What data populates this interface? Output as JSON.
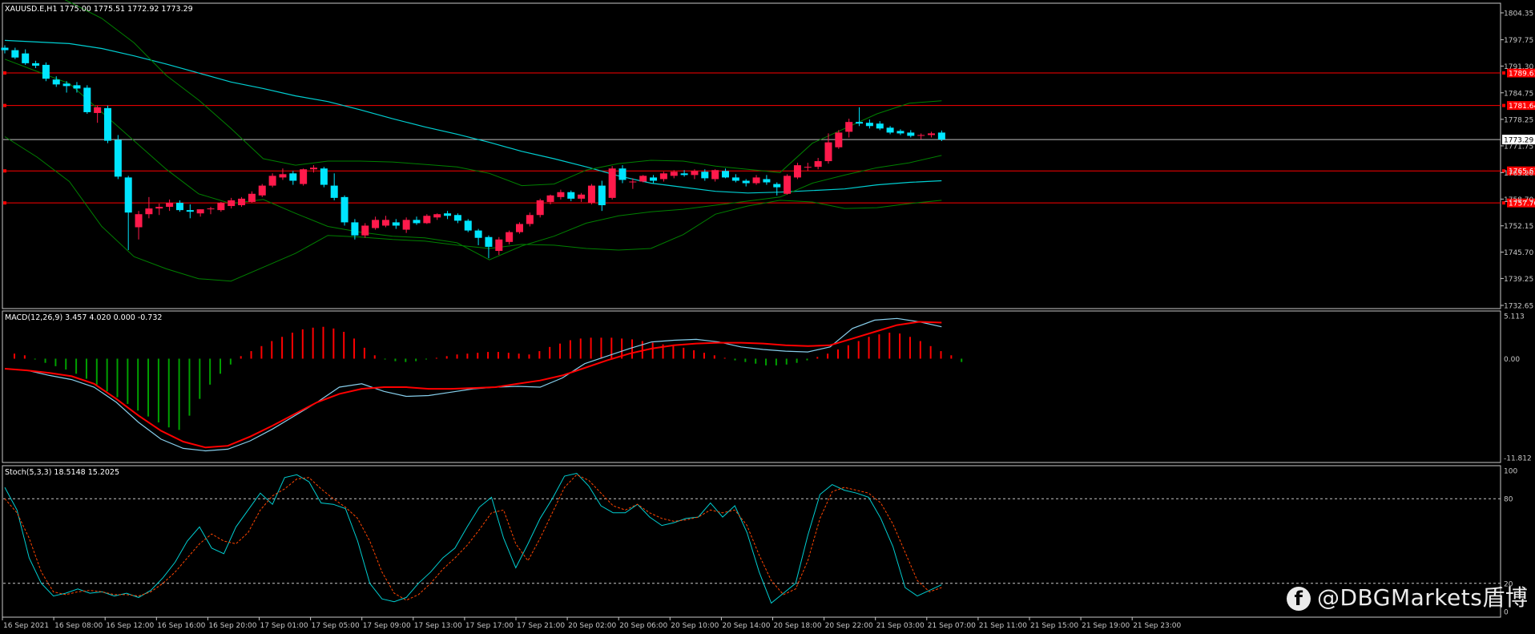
{
  "chart_data": [
    {
      "type": "candlestick",
      "title": "XAUUSD.E,H1  1775.00 1775.51 1772.92 1773.29",
      "symbol": "XAUUSD.E,H1",
      "ohlc_header": {
        "open": 1775.0,
        "high": 1775.51,
        "low": 1772.92,
        "close": 1773.29
      },
      "ylim": [
        1732.65,
        1804.35
      ],
      "y_ticks": [
        "1804.35",
        "1797.75",
        "1791.30",
        "1784.75",
        "1778.25",
        "1771.75",
        "1765.20",
        "1758.70",
        "1752.15",
        "1745.70",
        "1739.25",
        "1732.65"
      ],
      "x_tick_labels": [
        "16 Sep 2021",
        "16 Sep 08:00",
        "16 Sep 12:00",
        "16 Sep 16:00",
        "16 Sep 20:00",
        "17 Sep 01:00",
        "17 Sep 05:00",
        "17 Sep 09:00",
        "17 Sep 13:00",
        "17 Sep 17:00",
        "17 Sep 21:00",
        "20 Sep 02:00",
        "20 Sep 06:00",
        "20 Sep 10:00",
        "20 Sep 14:00",
        "20 Sep 18:00",
        "20 Sep 22:00",
        "21 Sep 03:00",
        "21 Sep 07:00",
        "21 Sep 11:00",
        "21 Sep 15:00",
        "21 Sep 19:00",
        "21 Sep 23:00"
      ],
      "current_price_label": "1773.29",
      "current_price": 1773.29,
      "horizontal_levels": [
        {
          "label": "1789.61",
          "price": 1789.61
        },
        {
          "label": "1781.64",
          "price": 1781.64
        },
        {
          "label": "1765.61",
          "price": 1765.61
        },
        {
          "label": "1757.76",
          "price": 1757.76
        }
      ],
      "candles": [
        [
          1795.8,
          1796.4,
          1794.4,
          1795.2
        ],
        [
          1795.2,
          1795.8,
          1793.0,
          1793.4
        ],
        [
          1794.4,
          1795.4,
          1791.6,
          1792.0
        ],
        [
          1792.0,
          1792.6,
          1790.8,
          1791.4
        ],
        [
          1791.6,
          1792.2,
          1787.6,
          1788.2
        ],
        [
          1788.0,
          1788.8,
          1786.2,
          1786.8
        ],
        [
          1787.0,
          1787.6,
          1784.8,
          1786.4
        ],
        [
          1786.6,
          1787.4,
          1784.8,
          1785.8
        ],
        [
          1786.0,
          1786.6,
          1779.6,
          1780.0
        ],
        [
          1779.8,
          1781.6,
          1777.4,
          1781.2
        ],
        [
          1781.0,
          1781.6,
          1772.4,
          1773.0
        ],
        [
          1773.2,
          1774.4,
          1763.6,
          1764.2
        ],
        [
          1764.0,
          1764.4,
          1746.2,
          1755.4
        ],
        [
          1751.8,
          1755.8,
          1748.8,
          1755.0
        ],
        [
          1755.0,
          1759.2,
          1754.0,
          1756.4
        ],
        [
          1756.4,
          1757.6,
          1754.8,
          1756.8
        ],
        [
          1756.8,
          1758.6,
          1755.8,
          1757.8
        ],
        [
          1757.8,
          1758.4,
          1755.6,
          1756.0
        ],
        [
          1756.0,
          1757.4,
          1754.0,
          1755.6
        ],
        [
          1755.2,
          1756.2,
          1754.4,
          1756.2
        ],
        [
          1756.2,
          1756.8,
          1755.0,
          1756.4
        ],
        [
          1756.0,
          1758.0,
          1755.6,
          1757.8
        ],
        [
          1757.0,
          1759.0,
          1756.4,
          1758.4
        ],
        [
          1757.2,
          1759.2,
          1756.8,
          1758.8
        ],
        [
          1758.0,
          1760.6,
          1757.8,
          1760.0
        ],
        [
          1759.6,
          1762.4,
          1759.2,
          1762.0
        ],
        [
          1762.0,
          1765.0,
          1761.6,
          1764.4
        ],
        [
          1764.0,
          1766.2,
          1763.4,
          1764.8
        ],
        [
          1765.0,
          1765.6,
          1762.2,
          1763.2
        ],
        [
          1762.4,
          1766.2,
          1762.0,
          1766.0
        ],
        [
          1766.0,
          1767.0,
          1765.2,
          1766.4
        ],
        [
          1766.2,
          1766.6,
          1761.6,
          1762.2
        ],
        [
          1762.0,
          1765.0,
          1758.4,
          1759.0
        ],
        [
          1759.2,
          1759.6,
          1752.2,
          1753.0
        ],
        [
          1753.0,
          1753.8,
          1748.8,
          1749.8
        ],
        [
          1749.8,
          1752.8,
          1749.2,
          1752.2
        ],
        [
          1751.6,
          1754.4,
          1751.2,
          1753.6
        ],
        [
          1752.2,
          1754.6,
          1751.8,
          1753.6
        ],
        [
          1753.0,
          1753.8,
          1751.4,
          1752.2
        ],
        [
          1751.2,
          1754.2,
          1750.4,
          1753.6
        ],
        [
          1753.6,
          1754.4,
          1752.4,
          1752.8
        ],
        [
          1752.8,
          1755.0,
          1752.6,
          1754.6
        ],
        [
          1754.2,
          1755.2,
          1753.6,
          1755.0
        ],
        [
          1755.2,
          1755.8,
          1753.8,
          1754.6
        ],
        [
          1754.8,
          1755.2,
          1752.8,
          1753.4
        ],
        [
          1753.4,
          1753.8,
          1750.6,
          1751.0
        ],
        [
          1751.0,
          1751.4,
          1747.4,
          1749.2
        ],
        [
          1749.4,
          1749.8,
          1744.2,
          1747.0
        ],
        [
          1746.0,
          1749.4,
          1745.0,
          1748.8
        ],
        [
          1748.2,
          1751.0,
          1747.6,
          1750.6
        ],
        [
          1750.6,
          1753.0,
          1750.2,
          1752.6
        ],
        [
          1752.6,
          1755.4,
          1752.0,
          1754.8
        ],
        [
          1754.8,
          1758.8,
          1754.2,
          1758.4
        ],
        [
          1758.0,
          1759.8,
          1757.4,
          1759.6
        ],
        [
          1759.2,
          1761.0,
          1758.6,
          1760.4
        ],
        [
          1760.4,
          1760.8,
          1758.2,
          1758.8
        ],
        [
          1758.8,
          1760.2,
          1758.0,
          1759.8
        ],
        [
          1757.8,
          1762.4,
          1757.4,
          1762.0
        ],
        [
          1762.0,
          1763.2,
          1755.8,
          1757.2
        ],
        [
          1759.0,
          1766.8,
          1758.6,
          1766.2
        ],
        [
          1766.2,
          1767.0,
          1762.6,
          1763.4
        ],
        [
          1763.0,
          1763.8,
          1761.2,
          1763.0
        ],
        [
          1763.0,
          1764.6,
          1762.8,
          1764.4
        ],
        [
          1764.0,
          1764.6,
          1762.6,
          1763.2
        ],
        [
          1763.6,
          1765.4,
          1763.0,
          1765.0
        ],
        [
          1764.4,
          1765.8,
          1763.8,
          1765.4
        ],
        [
          1765.0,
          1765.8,
          1764.2,
          1764.6
        ],
        [
          1764.6,
          1766.0,
          1763.6,
          1765.6
        ],
        [
          1765.4,
          1766.0,
          1763.2,
          1763.8
        ],
        [
          1763.6,
          1766.0,
          1763.0,
          1765.8
        ],
        [
          1765.6,
          1766.2,
          1763.8,
          1764.0
        ],
        [
          1764.0,
          1764.8,
          1762.8,
          1763.2
        ],
        [
          1763.2,
          1763.6,
          1761.8,
          1762.6
        ],
        [
          1762.6,
          1764.6,
          1762.2,
          1764.0
        ],
        [
          1763.6,
          1764.6,
          1762.2,
          1762.8
        ],
        [
          1762.4,
          1762.8,
          1759.6,
          1761.6
        ],
        [
          1760.0,
          1764.8,
          1759.8,
          1764.4
        ],
        [
          1764.0,
          1767.6,
          1763.6,
          1767.0
        ],
        [
          1766.6,
          1767.6,
          1765.6,
          1766.6
        ],
        [
          1766.6,
          1768.8,
          1766.0,
          1768.0
        ],
        [
          1768.0,
          1774.8,
          1767.4,
          1772.6
        ],
        [
          1771.4,
          1775.6,
          1771.0,
          1775.0
        ],
        [
          1775.2,
          1778.4,
          1773.8,
          1777.6
        ],
        [
          1777.6,
          1781.2,
          1776.6,
          1777.2
        ],
        [
          1777.4,
          1778.2,
          1776.0,
          1776.6
        ],
        [
          1777.2,
          1777.8,
          1775.6,
          1776.0
        ],
        [
          1776.2,
          1776.6,
          1774.6,
          1775.0
        ],
        [
          1775.4,
          1775.8,
          1774.4,
          1774.8
        ],
        [
          1775.0,
          1775.6,
          1773.8,
          1774.2
        ],
        [
          1774.2,
          1774.8,
          1773.4,
          1774.4
        ],
        [
          1774.4,
          1775.2,
          1773.8,
          1774.8
        ],
        [
          1775.0,
          1775.51,
          1772.92,
          1773.29
        ]
      ],
      "series": [
        {
          "name": "",
          "color": "#00ced1",
          "values": [
            1797.6,
            1797.2,
            1796.8,
            1795.6,
            1793.8,
            1791.8,
            1789.6,
            1787.4,
            1785.8,
            1784.0,
            1782.6,
            1780.6,
            1778.4,
            1776.4,
            1774.6,
            1772.6,
            1770.4,
            1768.6,
            1766.6,
            1764.4,
            1762.6,
            1761.6,
            1760.6,
            1760.2,
            1760.4,
            1760.8,
            1761.2,
            1762.2,
            1762.8,
            1763.2
          ]
        },
        {
          "name": "",
          "color": "#008000",
          "values": [
            1812.0,
            1811.0,
            1807.0,
            1803.0,
            1797.0,
            1789.0,
            1783.0,
            1776.0,
            1768.6,
            1767.0,
            1768.0,
            1768.0,
            1767.8,
            1767.2,
            1766.6,
            1765.0,
            1762.0,
            1762.4,
            1765.8,
            1767.4,
            1768.2,
            1768.0,
            1766.8,
            1766.0,
            1765.2,
            1772.4,
            1776.0,
            1779.6,
            1782.2,
            1782.8
          ]
        },
        {
          "name": "",
          "color": "#008000",
          "values": [
            1793.0,
            1790.0,
            1787.0,
            1780.0,
            1773.0,
            1766.0,
            1760.0,
            1757.6,
            1758.6,
            1755.2,
            1752.0,
            1750.6,
            1749.6,
            1749.2,
            1748.0,
            1743.8,
            1747.2,
            1749.6,
            1752.8,
            1754.6,
            1755.6,
            1756.2,
            1757.2,
            1758.2,
            1759.2,
            1762.6,
            1764.6,
            1766.4,
            1767.6,
            1769.4
          ]
        },
        {
          "name": "",
          "color": "#008000",
          "values": [
            1774.0,
            1769.0,
            1763.0,
            1752.0,
            1744.6,
            1741.6,
            1739.2,
            1738.6,
            1742.0,
            1745.4,
            1749.8,
            1749.4,
            1748.8,
            1748.4,
            1747.4,
            1746.6,
            1747.6,
            1747.4,
            1746.6,
            1746.2,
            1746.6,
            1750.0,
            1755.0,
            1757.0,
            1758.4,
            1758.0,
            1756.4,
            1756.6,
            1757.6,
            1758.4
          ]
        }
      ]
    },
    {
      "type": "macd",
      "title": "MACD(12,26,9) 3.457 4.020 0.000 -0.732",
      "ylim": [
        -11.812,
        5.113
      ],
      "y_ticks": [
        "5.113",
        "0.00",
        "-11.812"
      ],
      "histogram": [
        0.6,
        0.4,
        -0.1,
        -0.5,
        -0.9,
        -1.3,
        -1.8,
        -2.4,
        -3.1,
        -3.9,
        -4.6,
        -5.4,
        -6.2,
        -6.9,
        -7.6,
        -8.2,
        -8.5,
        -6.8,
        -4.8,
        -3.1,
        -1.8,
        -0.7,
        0.3,
        0.9,
        1.5,
        2.1,
        2.6,
        3.1,
        3.5,
        3.7,
        3.8,
        3.6,
        3.2,
        2.4,
        1.3,
        0.4,
        -0.1,
        -0.3,
        -0.4,
        -0.3,
        -0.1,
        0.1,
        0.3,
        0.5,
        0.6,
        0.7,
        0.8,
        0.8,
        0.7,
        0.6,
        0.5,
        0.9,
        1.4,
        1.8,
        2.2,
        2.4,
        2.5,
        2.5,
        2.5,
        2.4,
        2.3,
        2.1,
        1.9,
        1.7,
        1.5,
        1.3,
        1.0,
        0.7,
        0.4,
        0.1,
        -0.2,
        -0.4,
        -0.6,
        -0.8,
        -0.8,
        -0.7,
        -0.5,
        -0.2,
        0.2,
        0.6,
        1.1,
        1.6,
        2.1,
        2.6,
        2.9,
        3.1,
        3.0,
        2.6,
        2.1,
        1.5,
        0.9,
        0.4,
        -0.4
      ],
      "series": [
        {
          "name": "",
          "color": "#87ceeb",
          "values": [
            -1.2,
            -1.4,
            -2.0,
            -2.5,
            -3.4,
            -5.2,
            -7.6,
            -9.6,
            -10.7,
            -11.0,
            -10.8,
            -9.8,
            -8.4,
            -6.8,
            -5.2,
            -3.4,
            -3.0,
            -3.9,
            -4.5,
            -4.4,
            -4.0,
            -3.6,
            -3.4,
            -3.3,
            -3.4,
            -2.3,
            -0.6,
            0.3,
            1.2,
            2.0,
            2.2,
            2.3,
            2.0,
            1.4,
            1.1,
            0.9,
            0.8,
            1.4,
            3.6,
            4.6,
            4.8,
            4.4,
            3.8
          ]
        },
        {
          "name": "",
          "color": "#ff0000",
          "values": [
            -1.2,
            -1.4,
            -1.7,
            -2.1,
            -3.0,
            -4.8,
            -6.8,
            -8.6,
            -9.9,
            -10.6,
            -10.4,
            -9.3,
            -8.0,
            -6.6,
            -5.2,
            -4.2,
            -3.6,
            -3.4,
            -3.4,
            -3.6,
            -3.6,
            -3.5,
            -3.4,
            -3.0,
            -2.6,
            -2.0,
            -1.1,
            -0.2,
            0.6,
            1.2,
            1.6,
            1.8,
            1.9,
            1.9,
            1.8,
            1.6,
            1.5,
            1.6,
            2.4,
            3.2,
            4.0,
            4.4,
            4.3
          ]
        }
      ]
    },
    {
      "type": "stochastic",
      "title": "Stoch(5,3,3) 18.5148 15.2025",
      "ylim": [
        0,
        100
      ],
      "y_ticks": [
        "100",
        "80",
        "20",
        "0"
      ],
      "levels": [
        80,
        20
      ],
      "series": [
        {
          "name": "",
          "color": "#00ced1",
          "values": [
            88,
            72,
            38,
            20,
            11,
            13,
            16,
            13,
            14,
            11,
            13,
            10,
            15,
            24,
            35,
            50,
            60,
            45,
            41,
            60,
            72,
            84,
            76,
            95,
            97,
            92,
            77,
            76,
            73,
            50,
            20,
            9,
            7,
            10,
            20,
            28,
            38,
            45,
            60,
            74,
            81,
            52,
            31,
            48,
            66,
            80,
            96,
            98,
            89,
            75,
            70,
            70,
            76,
            67,
            61,
            63,
            66,
            67,
            77,
            67,
            75,
            56,
            28,
            6,
            13,
            20,
            54,
            83,
            90,
            86,
            84,
            81,
            66,
            46,
            17,
            11,
            15,
            19
          ]
        },
        {
          "name": "",
          "color": "#ff4500",
          "values": [
            80,
            70,
            52,
            28,
            14,
            12,
            14,
            15,
            14,
            12,
            12,
            11,
            14,
            20,
            28,
            38,
            48,
            55,
            50,
            48,
            56,
            72,
            82,
            87,
            94,
            95,
            87,
            80,
            74,
            66,
            50,
            28,
            13,
            8,
            12,
            20,
            30,
            38,
            47,
            58,
            70,
            72,
            48,
            36,
            52,
            70,
            88,
            97,
            93,
            84,
            75,
            72,
            76,
            70,
            66,
            64,
            65,
            67,
            72,
            70,
            72,
            61,
            40,
            22,
            12,
            16,
            36,
            66,
            85,
            88,
            86,
            84,
            77,
            62,
            42,
            22,
            14,
            17
          ]
        }
      ]
    }
  ],
  "watermark": {
    "text": "@DBGMarkets盾博",
    "icon": "f-logo-icon"
  }
}
